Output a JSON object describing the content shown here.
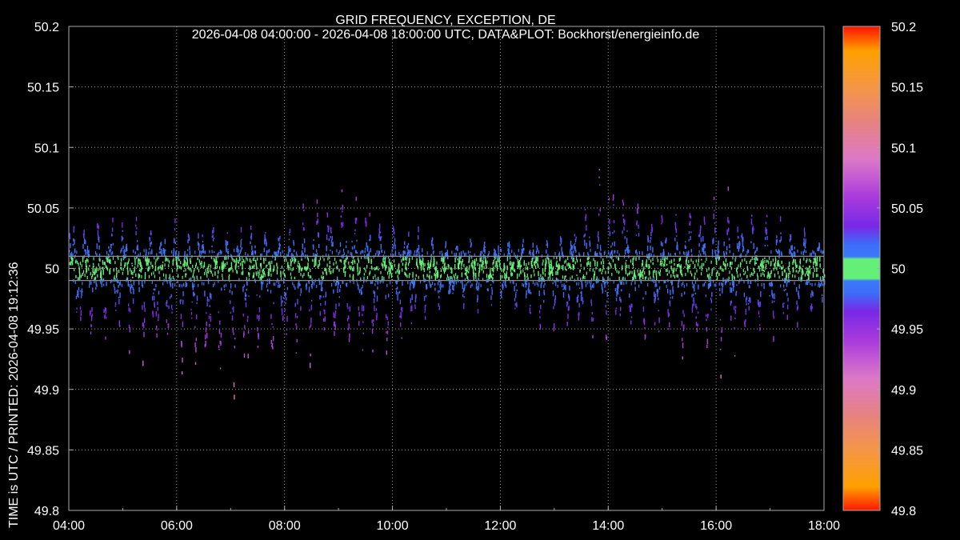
{
  "chart_data": {
    "type": "scatter",
    "title": "GRID FREQUENCY, EXCEPTION, DE",
    "subtitle": "2026-04-08 04:00:00 - 2026-04-08 18:00:00 UTC, DATA&PLOT: Bockhorst/energieinfo.de",
    "ylabel": "TIME is UTC / PRINTED: 2026-04-08 19:12:36",
    "xlabel": "",
    "x_ticks": [
      "04:00",
      "06:00",
      "08:00",
      "10:00",
      "12:00",
      "14:00",
      "16:00",
      "18:00"
    ],
    "xlim": [
      "04:00",
      "18:00"
    ],
    "ylim": [
      49.8,
      50.2
    ],
    "y_ticks": [
      "50.2",
      "50.15",
      "50.1",
      "50.05",
      "50",
      "49.95",
      "49.9",
      "49.85",
      "49.8"
    ],
    "reference_lines": [
      49.99,
      50.01
    ],
    "grid": true,
    "colorbar": {
      "range": [
        49.8,
        50.2
      ],
      "ticks": [
        "50.2",
        "50.15",
        "50.1",
        "50.05",
        "50",
        "49.95",
        "49.9",
        "49.85",
        "49.8"
      ]
    },
    "envelope_hourly": [
      {
        "time": "04:00",
        "min": 49.93,
        "max": 50.05
      },
      {
        "time": "05:00",
        "min": 49.925,
        "max": 50.05
      },
      {
        "time": "06:00",
        "min": 49.89,
        "max": 50.045
      },
      {
        "time": "07:00",
        "min": 49.88,
        "max": 50.045
      },
      {
        "time": "08:00",
        "min": 49.91,
        "max": 50.045
      },
      {
        "time": "09:00",
        "min": 49.915,
        "max": 50.085
      },
      {
        "time": "10:00",
        "min": 49.915,
        "max": 50.045
      },
      {
        "time": "11:00",
        "min": 49.96,
        "max": 50.03
      },
      {
        "time": "12:00",
        "min": 49.96,
        "max": 50.03
      },
      {
        "time": "13:00",
        "min": 49.935,
        "max": 50.03
      },
      {
        "time": "14:00",
        "min": 49.93,
        "max": 50.1
      },
      {
        "time": "15:00",
        "min": 49.925,
        "max": 50.055
      },
      {
        "time": "16:00",
        "min": 49.9,
        "max": 50.075
      },
      {
        "time": "17:00",
        "min": 49.93,
        "max": 50.06
      },
      {
        "time": "18:00",
        "min": 49.955,
        "max": 50.025
      }
    ]
  }
}
